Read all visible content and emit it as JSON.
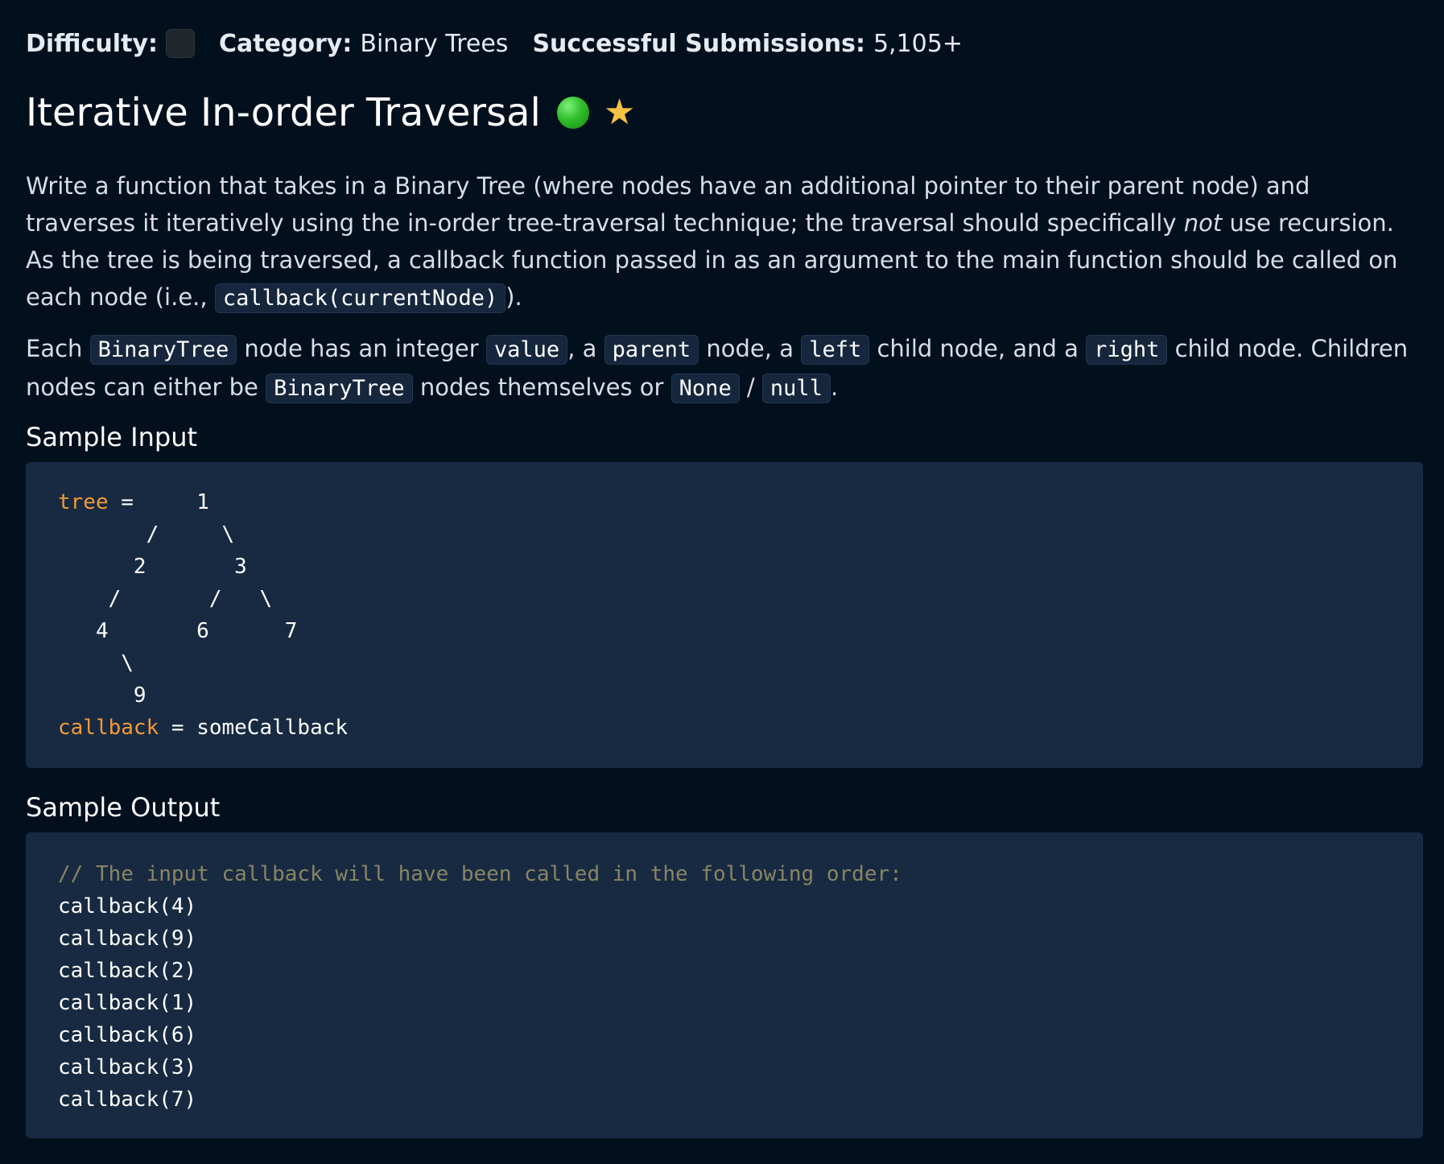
{
  "meta": {
    "difficulty_label": "Difficulty:",
    "category_label": "Category:",
    "category_value": "Binary Trees",
    "submissions_label": "Successful Submissions:",
    "submissions_value": "5,105+"
  },
  "title": "Iterative In-order Traversal",
  "description": {
    "p1_a": "Write a function that takes in a Binary Tree (where nodes have an additional pointer to their parent node) and traverses it iteratively using the in-order tree-traversal technique; the traversal should specifically ",
    "p1_em": "not",
    "p1_b": " use recursion. As the tree is being traversed, a callback function passed in as an argument to the main function should be called on each node (i.e., ",
    "p1_code": "callback(currentNode)",
    "p1_c": ").",
    "p2_a": "Each ",
    "p2_code1": "BinaryTree",
    "p2_b": " node has an integer ",
    "p2_code2": "value",
    "p2_c": ", a ",
    "p2_code3": "parent",
    "p2_d": " node, a ",
    "p2_code4": "left",
    "p2_e": " child node, and a ",
    "p2_code5": "right",
    "p2_f": " child node. Children nodes can either be ",
    "p2_code6": "BinaryTree",
    "p2_g": " nodes themselves or ",
    "p2_code7": "None",
    "p2_h": " / ",
    "p2_code8": "null",
    "p2_i": "."
  },
  "sample_input": {
    "heading": "Sample Input",
    "tree_kw": "tree",
    "tree_lines": [
      " =     1",
      "       /     \\",
      "      2       3",
      "    /       /   \\",
      "   4       6      7",
      "     \\",
      "      9"
    ],
    "callback_kw": "callback",
    "callback_rest": " = someCallback"
  },
  "sample_output": {
    "heading": "Sample Output",
    "comment": "// The input callback will have been called in the following order:",
    "lines": [
      "callback(4)",
      "callback(9)",
      "callback(2)",
      "callback(1)",
      "callback(6)",
      "callback(3)",
      "callback(7)"
    ]
  },
  "colors": {
    "background": "#020f1d",
    "code_bg": "#172a41",
    "keyword": "#f29a38",
    "comment": "#8a8465",
    "star": "#f6c445",
    "status_dot": "#2fbe2c"
  },
  "icons": [
    "difficulty-box-icon",
    "completed-dot-icon",
    "star-icon"
  ]
}
